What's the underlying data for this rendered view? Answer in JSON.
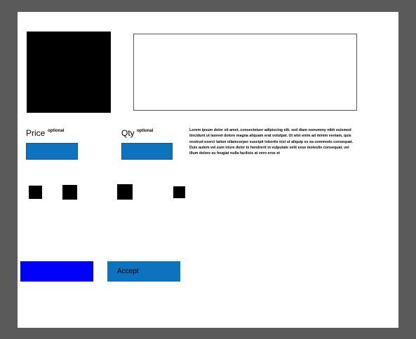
{
  "form": {
    "price": {
      "label": "Price",
      "hint": "optional",
      "value": ""
    },
    "qty": {
      "label": "Qty",
      "hint": "optional",
      "value": ""
    },
    "notes_value": "",
    "description": "Lorem ipsum dolor sit amet, consectetuer adipiscing elit, sed diam nonummy nibh euismod tincidunt ut laoreet dolore magna aliquam erat volutpat. Ut wisi enim ad minim veniam, quis nostrud exerci tation ullamcorper suscipit lobortis nisl ut aliquip ex ea commodo consequat. Duis autem vel eum iriure dolor in hendrerit in vulputate velit esse molestie consequat, vel illum dolore eu feugiat nulla facilisis at vero eros et"
  },
  "actions": {
    "primary_label": "",
    "accept_label": "Accept"
  },
  "colors": {
    "field_fill": "#0d73bf",
    "primary_button": "#0000ff",
    "accept_button": "#0d73bf",
    "canvas": "#ffffff",
    "backdrop": "#5a5a5a"
  }
}
